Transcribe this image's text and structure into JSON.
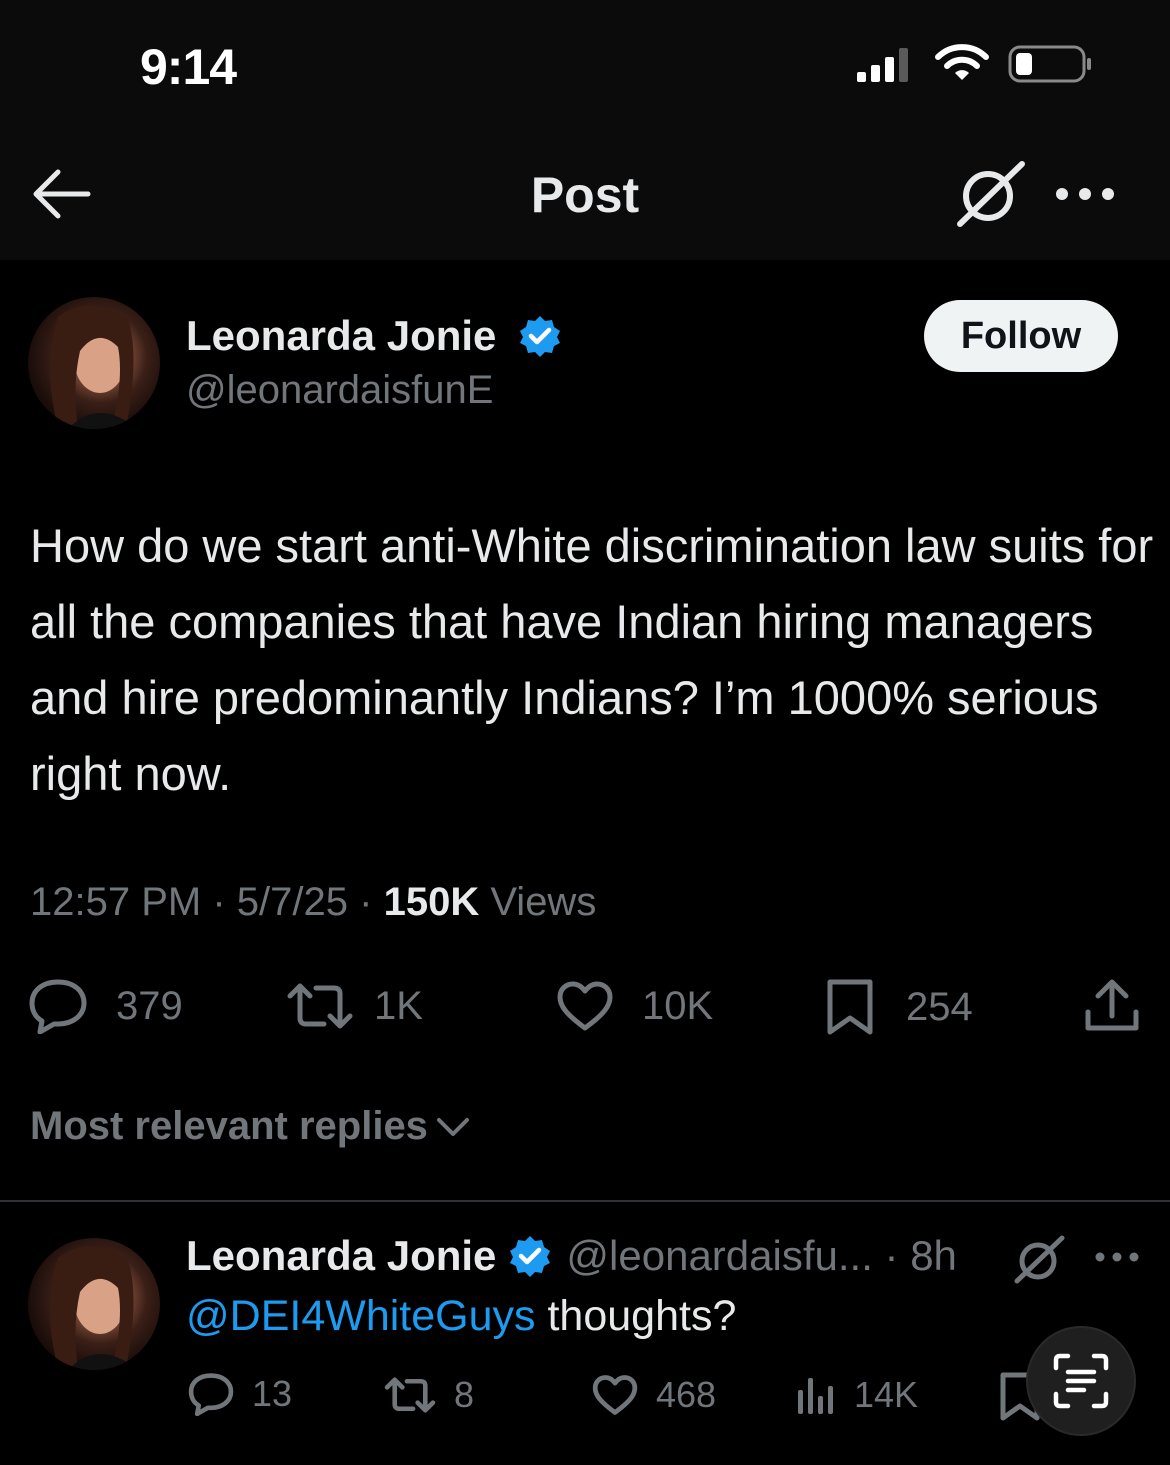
{
  "status_bar": {
    "time": "9:14",
    "icons": [
      "signal-icon",
      "wifi-icon",
      "battery-icon"
    ]
  },
  "nav": {
    "title": "Post",
    "icons": [
      "back-arrow-icon",
      "grok-icon",
      "more-icon"
    ]
  },
  "post": {
    "author_name": "Leonarda Jonie",
    "handle": "@leonardaisfunE",
    "verified": true,
    "follow_label": "Follow",
    "text": "How do we start anti-White discrimination law suits for all the companies that have Indian hiring managers and hire predominantly Indians? I’m 1000% serious right now.",
    "time": "12:57 PM",
    "date": "5/7/25",
    "views_count": "150K",
    "views_label": "Views",
    "separator": "·",
    "actions": {
      "replies": "379",
      "reposts": "1K",
      "likes": "10K",
      "bookmarks": "254"
    }
  },
  "replies_sort": {
    "label": "Most relevant replies"
  },
  "reply": {
    "author_name": "Leonarda Jonie",
    "handle_time": "@leonardaisfu... · 8h",
    "mention": "@DEI4WhiteGuys",
    "text": " thoughts?",
    "actions": {
      "replies": "13",
      "reposts": "8",
      "likes": "468",
      "views": "14K"
    }
  },
  "colors": {
    "background": "#000000",
    "primary_text": "#e7e9ea",
    "secondary_text": "#71767b",
    "accent": "#1d9bf0",
    "verified": "#1d9bf0",
    "follow_button_bg": "#eff3f4"
  }
}
